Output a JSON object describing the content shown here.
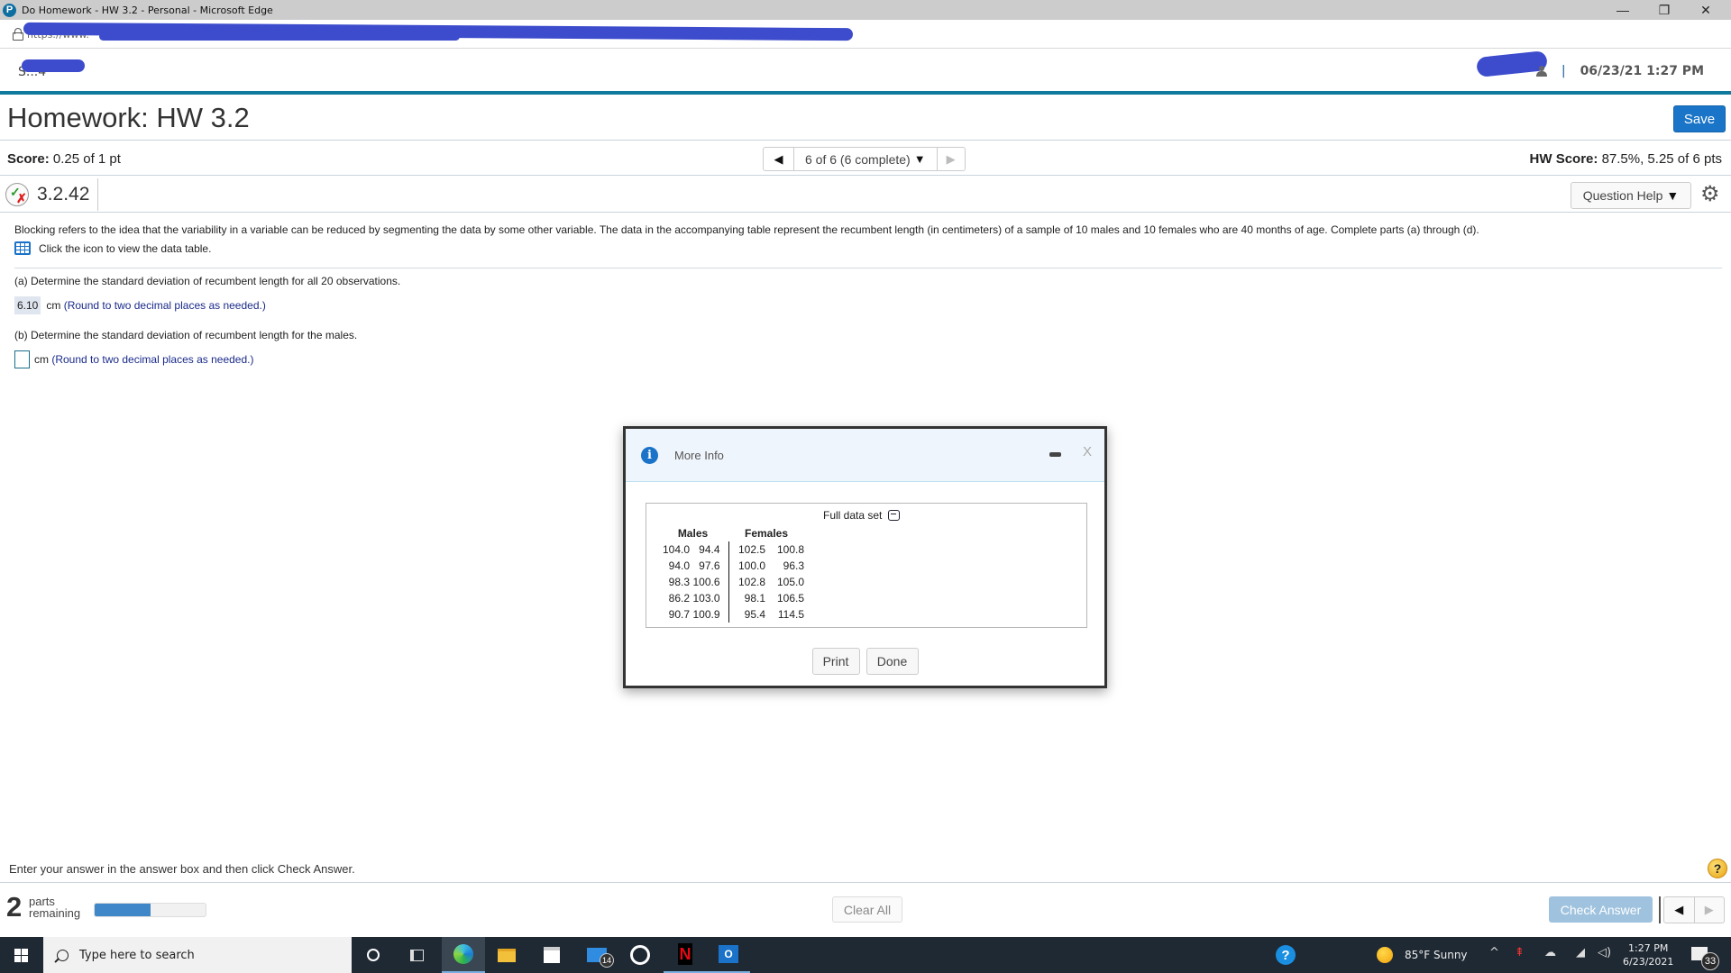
{
  "browser": {
    "window_title": "Do Homework - HW 3.2 - Personal - Microsoft Edge",
    "app_icon_glyph": "P",
    "url_prefix": "https://www.",
    "controls": {
      "minimize": "—",
      "restore": "❐",
      "close": "✕"
    }
  },
  "header": {
    "user_left_visible": "S...4",
    "datetime": "06/23/21 1:27 PM",
    "separator": "|"
  },
  "page": {
    "title": "Homework: HW 3.2",
    "save_label": "Save"
  },
  "score": {
    "label": "Score:",
    "value": "0.25 of 1 pt",
    "hw_label": "HW Score:",
    "hw_value": "87.5%, 5.25 of 6 pts"
  },
  "question_nav": {
    "prev_glyph": "◀",
    "current": "6 of 6 (6 complete)",
    "caret": "▼",
    "next_glyph": "▶"
  },
  "question": {
    "number": "3.2.42",
    "help_label": "Question Help",
    "help_caret": "▼",
    "gear_glyph": "⚙",
    "status_check": "✓",
    "status_x": "✗"
  },
  "problem": {
    "text": "Blocking refers to the idea that the variability in a variable can be reduced by segmenting the data by some other variable. The data in the accompanying table represent the recumbent length (in centimeters) of a sample of 10 males and 10 females who are 40 months of age. Complete parts (a) through (d).",
    "data_link": "Click the icon to view the data table."
  },
  "parts": {
    "a": {
      "prompt": "(a) Determine the standard deviation of recumbent length for all 20 observations.",
      "answer": "6.10",
      "unit": "cm",
      "hint": "(Round to two decimal places as needed.)"
    },
    "b": {
      "prompt": "(b) Determine the standard deviation of recumbent length for the males.",
      "answer": "",
      "unit": "cm",
      "hint": "(Round to two decimal places as needed.)"
    }
  },
  "modal": {
    "title": "More Info",
    "info_glyph": "i",
    "close_glyph": "X",
    "full_data_label": "Full data set",
    "headers": {
      "males": "Males",
      "females": "Females"
    },
    "rows": [
      [
        "104.0",
        "94.4",
        "102.5",
        "100.8"
      ],
      [
        "94.0",
        "97.6",
        "100.0",
        "96.3"
      ],
      [
        "98.3",
        "100.6",
        "102.8",
        "105.0"
      ],
      [
        "86.2",
        "103.0",
        "98.1",
        "106.5"
      ],
      [
        "90.7",
        "100.9",
        "95.4",
        "114.5"
      ]
    ],
    "print_label": "Print",
    "done_label": "Done"
  },
  "footer": {
    "hint": "Enter your answer in the answer box and then click Check Answer.",
    "help_glyph": "?",
    "parts_remaining_count": "2",
    "parts_label_1": "parts",
    "parts_label_2": "remaining",
    "progress_percent": 50,
    "progress_color": "#3f87c9",
    "clear_label": "Clear All",
    "check_label": "Check Answer",
    "prev_glyph": "◀",
    "next_glyph": "▶"
  },
  "taskbar": {
    "search_placeholder": "Type here to search",
    "mail_badge": "14",
    "tray_help_glyph": "?",
    "weather": "85°F  Sunny",
    "tray_chevron": "^",
    "clock_time": "1:27 PM",
    "clock_date": "6/23/2021",
    "notification_count": "33",
    "netflix_glyph": "N",
    "outlook_glyph": "O"
  },
  "colors": {
    "accent": "#1a75c8",
    "header_rule": "#0f7a9c",
    "hint_text": "#1a2a8a",
    "check_disabled": "#9fc2de"
  }
}
